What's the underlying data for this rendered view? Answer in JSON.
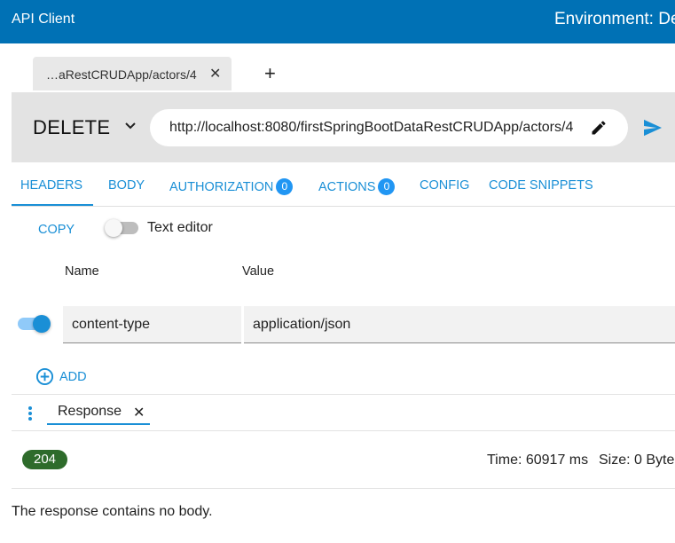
{
  "app": {
    "title": "API Client",
    "environment": "Environment: De"
  },
  "tabs": {
    "active_label": "…aRestCRUDApp/actors/4",
    "close": "✕",
    "new_tab": "+"
  },
  "request": {
    "method": "DELETE",
    "url": "http://localhost:8080/firstSpringBootDataRestCRUDApp/actors/4"
  },
  "request_tabs": {
    "headers": "HEADERS",
    "body": "BODY",
    "authorization": "AUTHORIZATION",
    "authorization_count": "0",
    "actions": "ACTIONS",
    "actions_count": "0",
    "config": "CONFIG",
    "code_snippets": "CODE SNIPPETS"
  },
  "headers_panel": {
    "copy": "COPY",
    "text_editor": "Text editor",
    "text_editor_enabled": false,
    "column_name": "Name",
    "column_value": "Value",
    "rows": [
      {
        "enabled": true,
        "name": "content-type",
        "value": "application/json"
      }
    ],
    "add": "ADD"
  },
  "response": {
    "tab_label": "Response",
    "tab_close": "✕",
    "status": "204",
    "time": "Time: 60917 ms",
    "size": "Size: 0 Byte",
    "body_message": "The response contains no body."
  },
  "colors": {
    "topbar": "#0071b5",
    "accent": "#1a8fd6",
    "status_success": "#2e6b2b"
  },
  "icons": {
    "method_dropdown": "chevron-down-icon",
    "edit": "pencil-icon",
    "send": "send-icon",
    "add": "plus-circle-icon",
    "menu": "kebab-icon"
  }
}
